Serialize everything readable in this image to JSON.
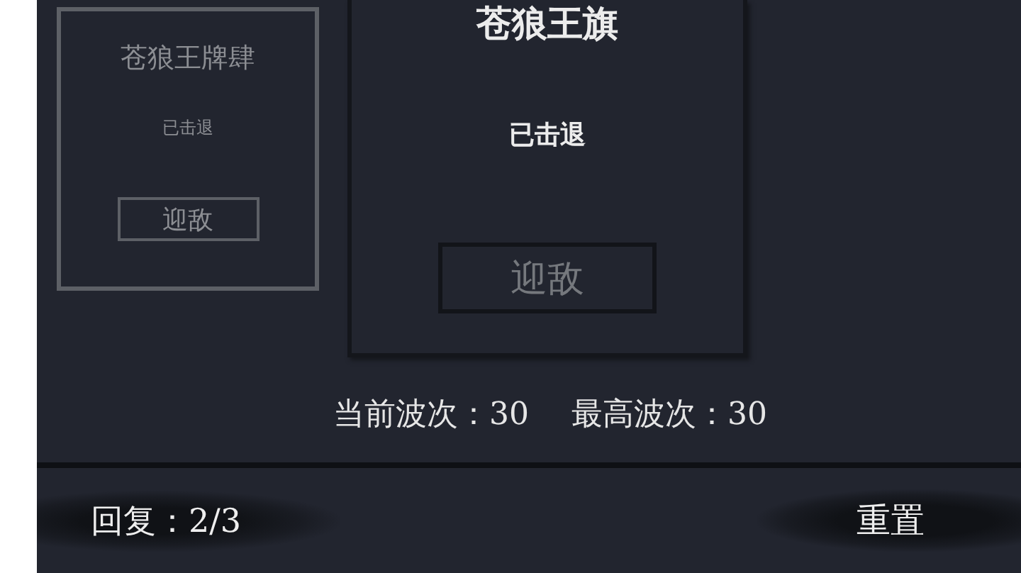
{
  "cards": [
    {
      "title": "苍狼王牌肆",
      "status": "已击退",
      "button": "迎敌",
      "selected": false
    },
    {
      "title": "苍狼王旗",
      "status": "已击退",
      "button": "迎敌",
      "selected": true
    }
  ],
  "waves": {
    "current_label": "当前波次：30",
    "best_label": "最高波次：30"
  },
  "footer": {
    "recovery": "回复：2/3",
    "reset_button": "重置"
  }
}
